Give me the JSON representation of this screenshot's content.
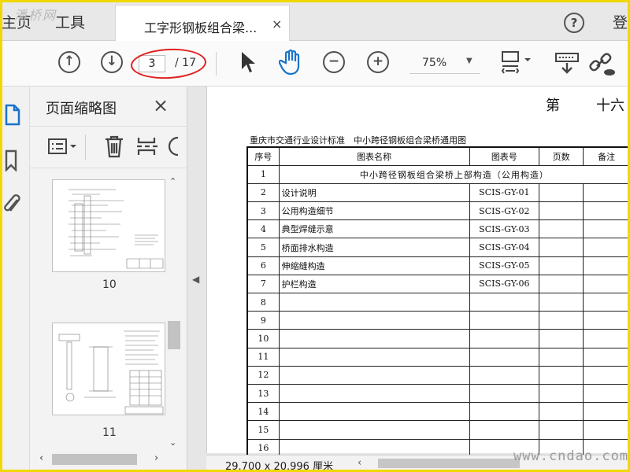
{
  "tabs": {
    "home_label": "主页",
    "tools_label": "工具",
    "doc_title": "工字形钢板组合梁...",
    "close_glyph": "×",
    "help_glyph": "?",
    "login_label": "登"
  },
  "watermark_top": "潘桥网",
  "toolbar": {
    "page_current": "3",
    "page_total": "/ 17",
    "zoom": "75%"
  },
  "thumbnails": {
    "title": "页面缩略图",
    "close_glyph": "×",
    "items": [
      {
        "label": "10"
      },
      {
        "label": "11"
      }
    ]
  },
  "document": {
    "header_left": "第",
    "header_right": "十六",
    "caption": "重庆市交通行业设计标准　中小跨径钢板组合梁桥通用图",
    "columns": [
      "序号",
      "图表名称",
      "图表号",
      "页数",
      "备注"
    ],
    "section_row": {
      "no": "1",
      "title": "中小跨径钢板组合梁桥上部构造（公用构造）"
    },
    "rows": [
      {
        "no": "2",
        "name": "设计说明",
        "code": "SCIS-GY-01"
      },
      {
        "no": "3",
        "name": "公用构造细节",
        "code": "SCIS-GY-02"
      },
      {
        "no": "4",
        "name": "典型焊缝示意",
        "code": "SCIS-GY-03"
      },
      {
        "no": "5",
        "name": "桥面排水构造",
        "code": "SCIS-GY-04"
      },
      {
        "no": "6",
        "name": "伸缩缝构造",
        "code": "SCIS-GY-05"
      },
      {
        "no": "7",
        "name": "护栏构造",
        "code": "SCIS-GY-06"
      },
      {
        "no": "8",
        "name": "",
        "code": ""
      },
      {
        "no": "9",
        "name": "",
        "code": ""
      },
      {
        "no": "10",
        "name": "",
        "code": ""
      },
      {
        "no": "11",
        "name": "",
        "code": ""
      },
      {
        "no": "12",
        "name": "",
        "code": ""
      },
      {
        "no": "13",
        "name": "",
        "code": ""
      },
      {
        "no": "14",
        "name": "",
        "code": ""
      },
      {
        "no": "15",
        "name": "",
        "code": ""
      },
      {
        "no": "16",
        "name": "",
        "code": ""
      }
    ]
  },
  "status": {
    "page_size": "29.700 x 20.996 厘米"
  },
  "watermark_site": "www.cndao.com",
  "colors": {
    "frame": "#f0d800",
    "annotation": "#e02020",
    "hand_tool": "#1a73c8"
  }
}
